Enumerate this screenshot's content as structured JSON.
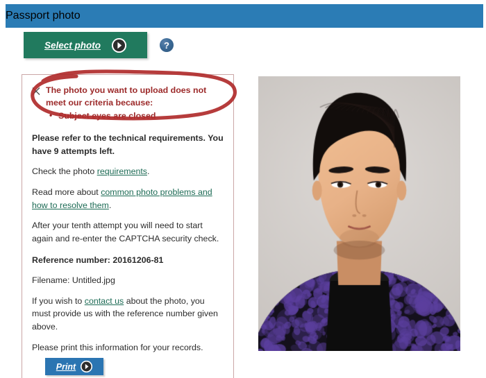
{
  "header": {
    "title": "Passport photo",
    "bar_color": "#2b7cb5"
  },
  "toolbar": {
    "select_photo_label": "Select photo",
    "select_photo_color": "#217a5e",
    "arrow_icon": "chevron-right-circle-icon",
    "help_icon": "question-mark-icon",
    "help_glyph": "?"
  },
  "error": {
    "icon": "x-mark-icon",
    "headline": "The photo you want to upload does not meet our criteria because:",
    "reasons": [
      "Subject eyes are closed"
    ],
    "color": "#9c2a2a"
  },
  "info": {
    "technical_requirements_line": "Please refer to the technical requirements. You have 9 attempts left.",
    "check_prefix": "Check the photo ",
    "check_link": "requirements",
    "check_suffix": ".",
    "read_prefix": "Read more about ",
    "read_link": "common photo problems and how to resolve them",
    "read_suffix": ".",
    "tenth_attempt": "After your tenth attempt you will need to start again and re-enter the CAPTCHA security check.",
    "reference_label": "Reference number: 20161206-81",
    "filename_label": "Filename: Untitled.jpg",
    "contact_prefix": "If you wish to ",
    "contact_link": "contact us",
    "contact_suffix": " about the photo, you must provide us with the reference number given above.",
    "print_note": "Please print this information for your records.",
    "link_color": "#1d6b55"
  },
  "print": {
    "label": "Print",
    "arrow_icon": "chevron-right-circle-icon",
    "color": "#2b75b2"
  },
  "annotation": {
    "shape": "hand-drawn-red-ellipse",
    "color": "#b02b2b"
  },
  "photo": {
    "alt": "passport photo of a person",
    "background_color": "#d2cecb",
    "hair_color": "#120d0b",
    "skin_color": "#e8b288",
    "jacket_color": "#5b3f9e",
    "shirt_color": "#0d0d0d"
  }
}
